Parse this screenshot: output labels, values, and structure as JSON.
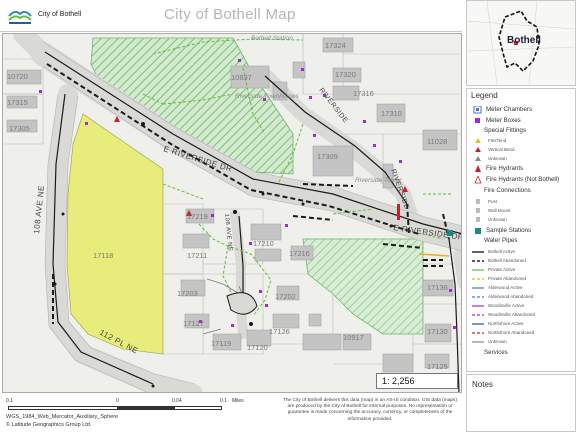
{
  "header": {
    "org_name": "City of Bothell",
    "title": "City of Bothell Map"
  },
  "map": {
    "parcel_labels": [
      {
        "id": "p1",
        "text": "10720"
      },
      {
        "id": "p2",
        "text": "17315"
      },
      {
        "id": "p3",
        "text": "17305"
      },
      {
        "id": "p4",
        "text": "17324"
      },
      {
        "id": "p5",
        "text": "17320"
      },
      {
        "id": "p6",
        "text": "17316"
      },
      {
        "id": "p7",
        "text": "17310"
      },
      {
        "id": "p8",
        "text": "11028"
      },
      {
        "id": "p9",
        "text": "10837"
      },
      {
        "id": "p10",
        "text": "17309"
      },
      {
        "id": "p11",
        "text": "17219"
      },
      {
        "id": "p12",
        "text": "17211"
      },
      {
        "id": "p13",
        "text": "17210"
      },
      {
        "id": "p14",
        "text": "17216"
      },
      {
        "id": "p15",
        "text": "17118"
      },
      {
        "id": "p16",
        "text": "17203"
      },
      {
        "id": "p17",
        "text": "17202"
      },
      {
        "id": "p18",
        "text": "17127"
      },
      {
        "id": "p19",
        "text": "17126"
      },
      {
        "id": "p20",
        "text": "17119"
      },
      {
        "id": "p21",
        "text": "17120"
      },
      {
        "id": "p22",
        "text": "10917"
      },
      {
        "id": "p23",
        "text": "17136"
      },
      {
        "id": "p24",
        "text": "17130"
      },
      {
        "id": "p25",
        "text": "17125"
      }
    ],
    "area_labels": {
      "bothell_station": "Bothell Station",
      "riverside_townhomes": "Riverside Townhomes",
      "riverside_tower": "Riverside Tower"
    },
    "street_labels": {
      "riverside_dr_west": "E RIVERSIDE DR",
      "riverside_dr_east": "E RIVERSIDE DR",
      "ave_108": "108 AVE NE",
      "pl_112": "112 PL NE",
      "ave_108_short": "108 AVE NE",
      "riverside_ne_1": "RIVERSIDE",
      "riverside_ne_2": "RIVERSIDE"
    },
    "scale": "1: 2,256"
  },
  "footer": {
    "scale_ticks": [
      "0.1",
      "0",
      "0.04",
      "0.1",
      "Miles"
    ],
    "projection": "WGS_1984_Web_Mercator_Auxiliary_Sphere",
    "copyright": "© Latitude Geographics Group Ltd.",
    "disclaimer": "The City of Bothell delivers this data (map) in an AS-IS condition. GIS data (maps) are produced by the City of Bothell for internal purposes. No representation or guarantee is made concerning the accuracy, currency, or completeness of the information provided."
  },
  "overview": {
    "label": "Bothell"
  },
  "legend": {
    "title": "Legend",
    "items": [
      {
        "label": "Meter Chambers",
        "size": "big",
        "icon": "meter-chamber-icon"
      },
      {
        "label": "Meter Boxes",
        "size": "big",
        "icon": "meter-box-icon"
      },
      {
        "label": "Special Fittings",
        "size": "head"
      },
      {
        "label": "FlexTend",
        "size": "small",
        "icon": "flextend-icon"
      },
      {
        "label": "Vertical Bend",
        "size": "small",
        "icon": "vertical-bend-icon"
      },
      {
        "label": "Unknown",
        "size": "small",
        "icon": "unknown-fitting-icon"
      },
      {
        "label": "Fire Hydrants",
        "size": "big",
        "icon": "fire-hydrant-icon"
      },
      {
        "label": "Fire Hydrants (Not Bothell)",
        "size": "big",
        "icon": "fire-hydrant-other-icon"
      },
      {
        "label": "Fire Connections",
        "size": "head"
      },
      {
        "label": "Post",
        "size": "small",
        "icon": "post-icon"
      },
      {
        "label": "Wall Mount",
        "size": "small",
        "icon": "wall-mount-icon"
      },
      {
        "label": "Unknown",
        "size": "small",
        "icon": "unknown-connection-icon"
      },
      {
        "label": "Sample Stations",
        "size": "big",
        "icon": "sample-station-icon"
      },
      {
        "label": "Water Pipes",
        "size": "head"
      },
      {
        "label": "Bothell Active",
        "size": "small",
        "icon": "line-bothell-active"
      },
      {
        "label": "Bothell Abandoned",
        "size": "small",
        "icon": "line-bothell-abandoned"
      },
      {
        "label": "Private Active",
        "size": "small",
        "icon": "line-private-active"
      },
      {
        "label": "Private Abandoned",
        "size": "small",
        "icon": "line-private-abandoned"
      },
      {
        "label": "Alderwood Active",
        "size": "small",
        "icon": "line-alderwood-active"
      },
      {
        "label": "Alderwood Abandoned",
        "size": "small",
        "icon": "line-alderwood-abandoned"
      },
      {
        "label": "Woodinville Active",
        "size": "small",
        "icon": "line-woodinville-active"
      },
      {
        "label": "Woodinville Abandoned",
        "size": "small",
        "icon": "line-woodinville-abandoned"
      },
      {
        "label": "Northshore Active",
        "size": "small",
        "icon": "line-northshore-active"
      },
      {
        "label": "Northshore Abandoned",
        "size": "small",
        "icon": "line-northshore-abandoned"
      },
      {
        "label": "Unknown",
        "size": "small",
        "icon": "line-unknown"
      },
      {
        "label": "Services",
        "size": "head"
      }
    ]
  },
  "notes": {
    "title": "Notes"
  },
  "colors": {
    "water_line": "#1a1a1a",
    "green_dash": "#5fbf3a",
    "hatch_green": "#6db56d",
    "parcel_yellow": "#e8ec7a",
    "building_gray": "#c4c4c4",
    "meter_purple": "#9b30c8",
    "hydrant_red": "#c8202a",
    "sample_teal": "#1a8a8a"
  }
}
